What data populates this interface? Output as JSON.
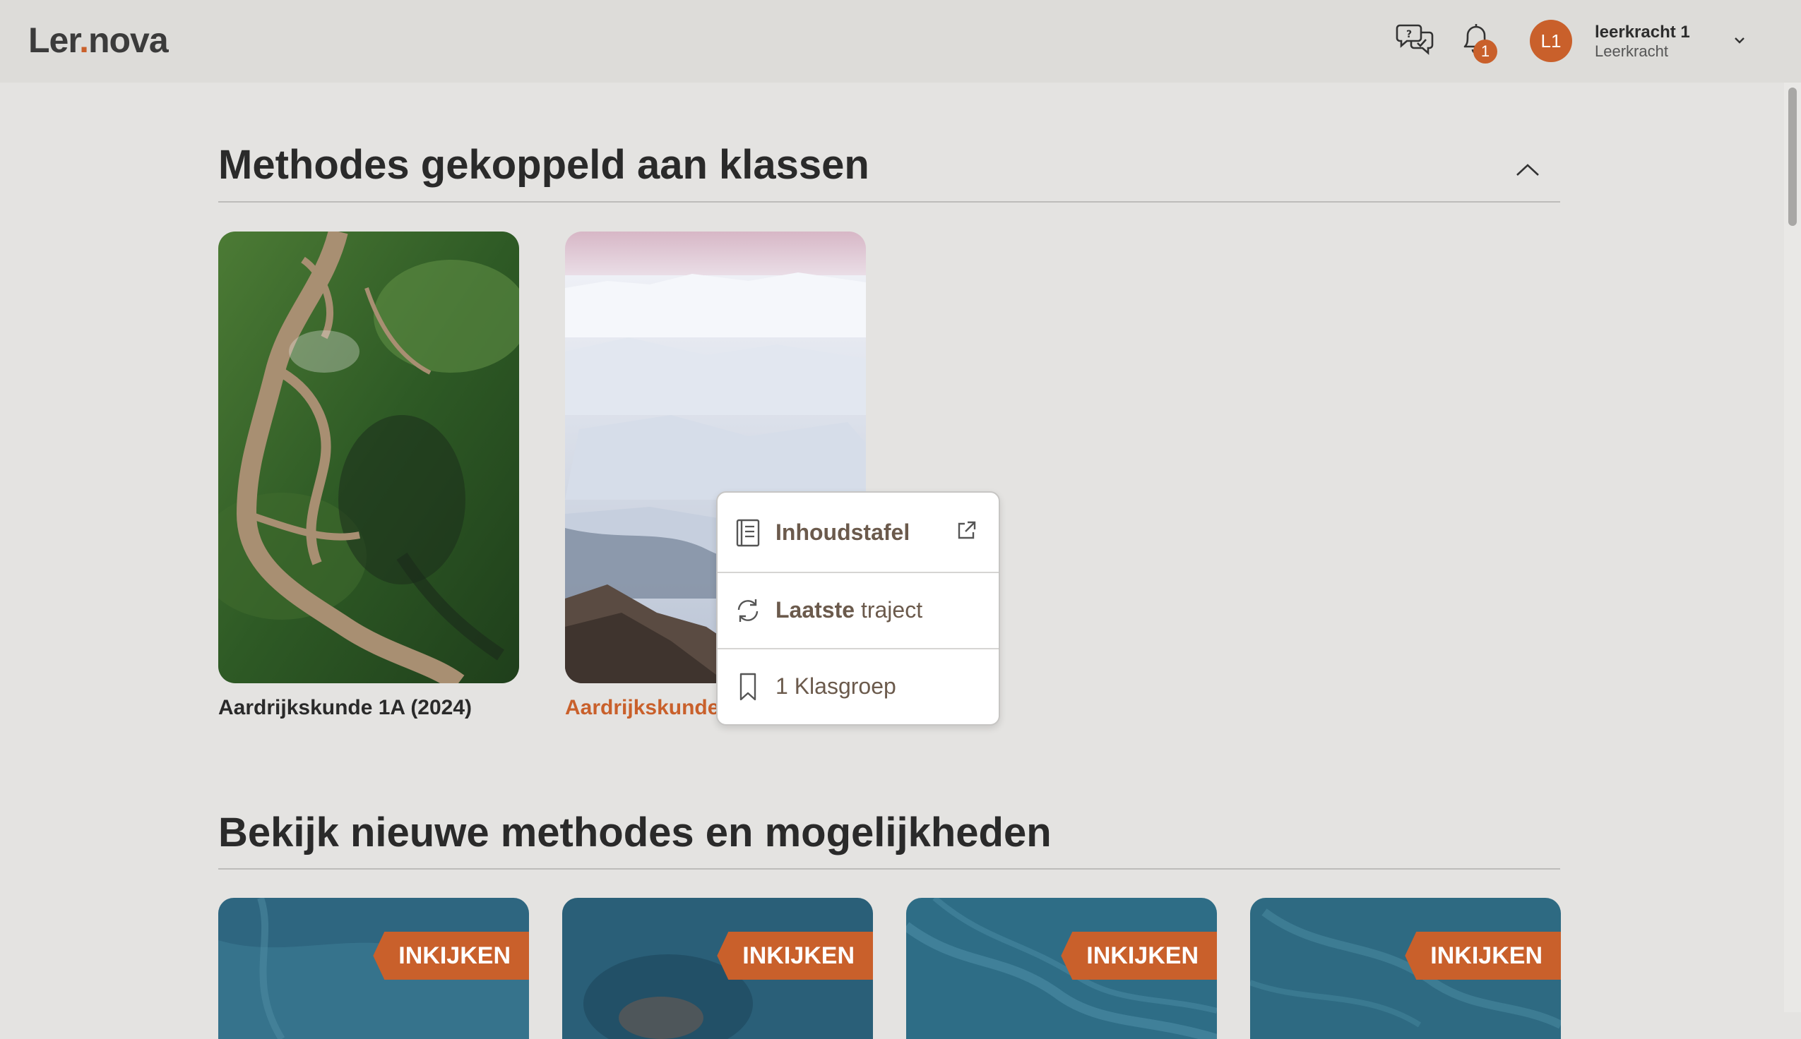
{
  "header": {
    "logo_text": "Lernova",
    "notifications_count": "1",
    "user": {
      "initials": "L1",
      "name": "leerkracht 1",
      "role": "Leerkracht"
    }
  },
  "section_linked": {
    "title": "Methodes gekoppeld aan klassen",
    "books": [
      {
        "title": "Aardrijkskunde 1A (2024)"
      },
      {
        "title": "Aardrijkskunde"
      }
    ]
  },
  "context_menu": {
    "toc": "Inhoudstafel",
    "last_bold": "Laatste",
    "last_rest": " traject",
    "group": "1 Klasgroep"
  },
  "section_new": {
    "title": "Bekijk nieuwe methodes en mogelijkheden",
    "badge_label": "INKIJKEN"
  },
  "colors": {
    "accent": "#c9602b",
    "background": "#e4e3e1",
    "header": "#dddcd9"
  }
}
